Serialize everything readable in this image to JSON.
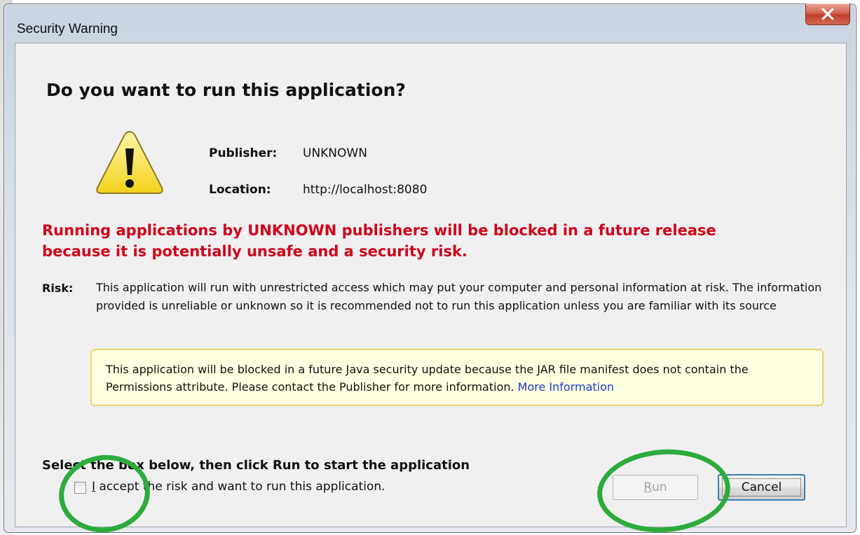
{
  "window": {
    "title": "Security Warning",
    "close_label": "X"
  },
  "dialog": {
    "heading": "Do you want to run this application?",
    "icon": "warning-triangle-icon",
    "publisher": {
      "label": "Publisher:",
      "value": "UNKNOWN"
    },
    "location": {
      "label": "Location:",
      "value": "http://localhost:8080"
    },
    "warning_line1": "Running applications by UNKNOWN publishers will be blocked in a future release",
    "warning_line2": "because it is potentially unsafe and a security risk.",
    "risk_label": "Risk:",
    "risk_text": "This application will run with unrestricted access which may put your computer and personal information at risk. The information provided is unreliable or unknown so it is recommended not to run this application unless you are familiar with its source",
    "info_text": "This application will be blocked in a future Java security update because the JAR file manifest does not contain the Permissions attribute. Please contact the Publisher for more information.",
    "info_link": "More Information",
    "instruction": "Select the box below, then click Run to start the application",
    "checkbox": {
      "label_mnemonic": "I",
      "label_rest": " accept the risk and want to run this application.",
      "checked": false
    },
    "buttons": {
      "run_mnemonic": "R",
      "run_rest": "un",
      "run_enabled": false,
      "cancel": "Cancel"
    }
  },
  "colors": {
    "warning_red": "#d0021b",
    "link_blue": "#1e3cc8",
    "info_bg": "#ffffe1",
    "annotation_green": "#2dab3c"
  }
}
